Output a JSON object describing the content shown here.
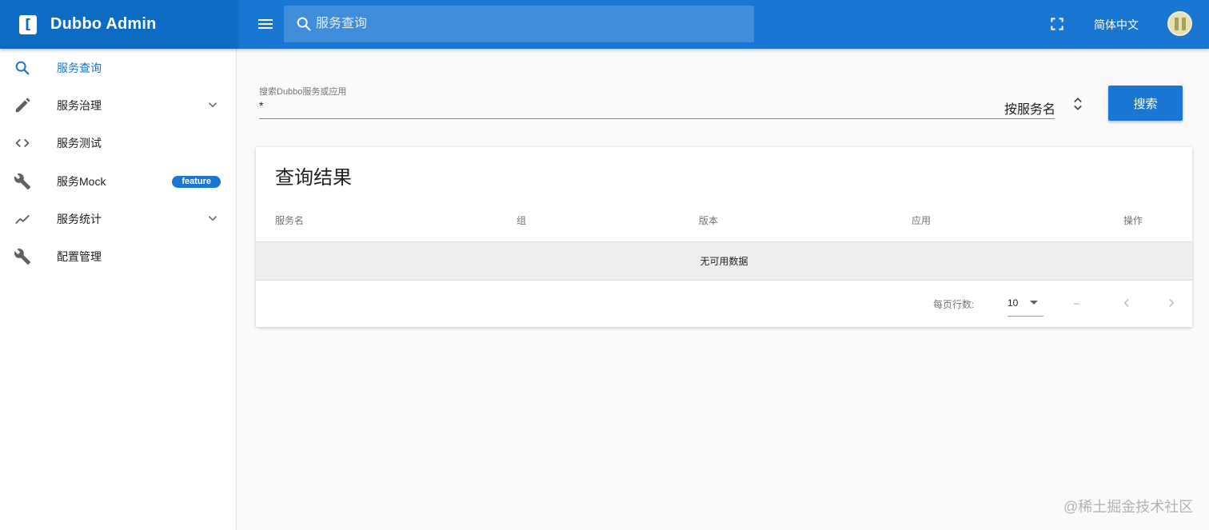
{
  "brand": {
    "logo_letter": "[",
    "title": "Dubbo Admin"
  },
  "sidebar": {
    "items": [
      {
        "label": "服务查询",
        "icon": "search-icon",
        "active": true
      },
      {
        "label": "服务治理",
        "icon": "pencil-icon",
        "expandable": true
      },
      {
        "label": "服务测试",
        "icon": "code-icon"
      },
      {
        "label": "服务Mock",
        "icon": "wrench-icon",
        "badge": "feature"
      },
      {
        "label": "服务统计",
        "icon": "trending-icon",
        "expandable": true
      },
      {
        "label": "配置管理",
        "icon": "wrench-icon"
      }
    ]
  },
  "topbar": {
    "search_placeholder": "服务查询",
    "language": "简体中文"
  },
  "search_form": {
    "label": "搜索Dubbo服务或应用",
    "value": "*",
    "search_by": "按服务名",
    "button": "搜索"
  },
  "results": {
    "title": "查询结果",
    "columns": [
      "服务名",
      "组",
      "版本",
      "应用",
      "操作"
    ],
    "empty_text": "无可用数据",
    "rows_per_page_label": "每页行数:",
    "rows_per_page": "10",
    "range": "–"
  },
  "watermark": "@稀土掘金技术社区",
  "colors": {
    "primary": "#1976d2",
    "brand_dark": "#0d6bc4",
    "search_bg": "#3f8ddb"
  }
}
